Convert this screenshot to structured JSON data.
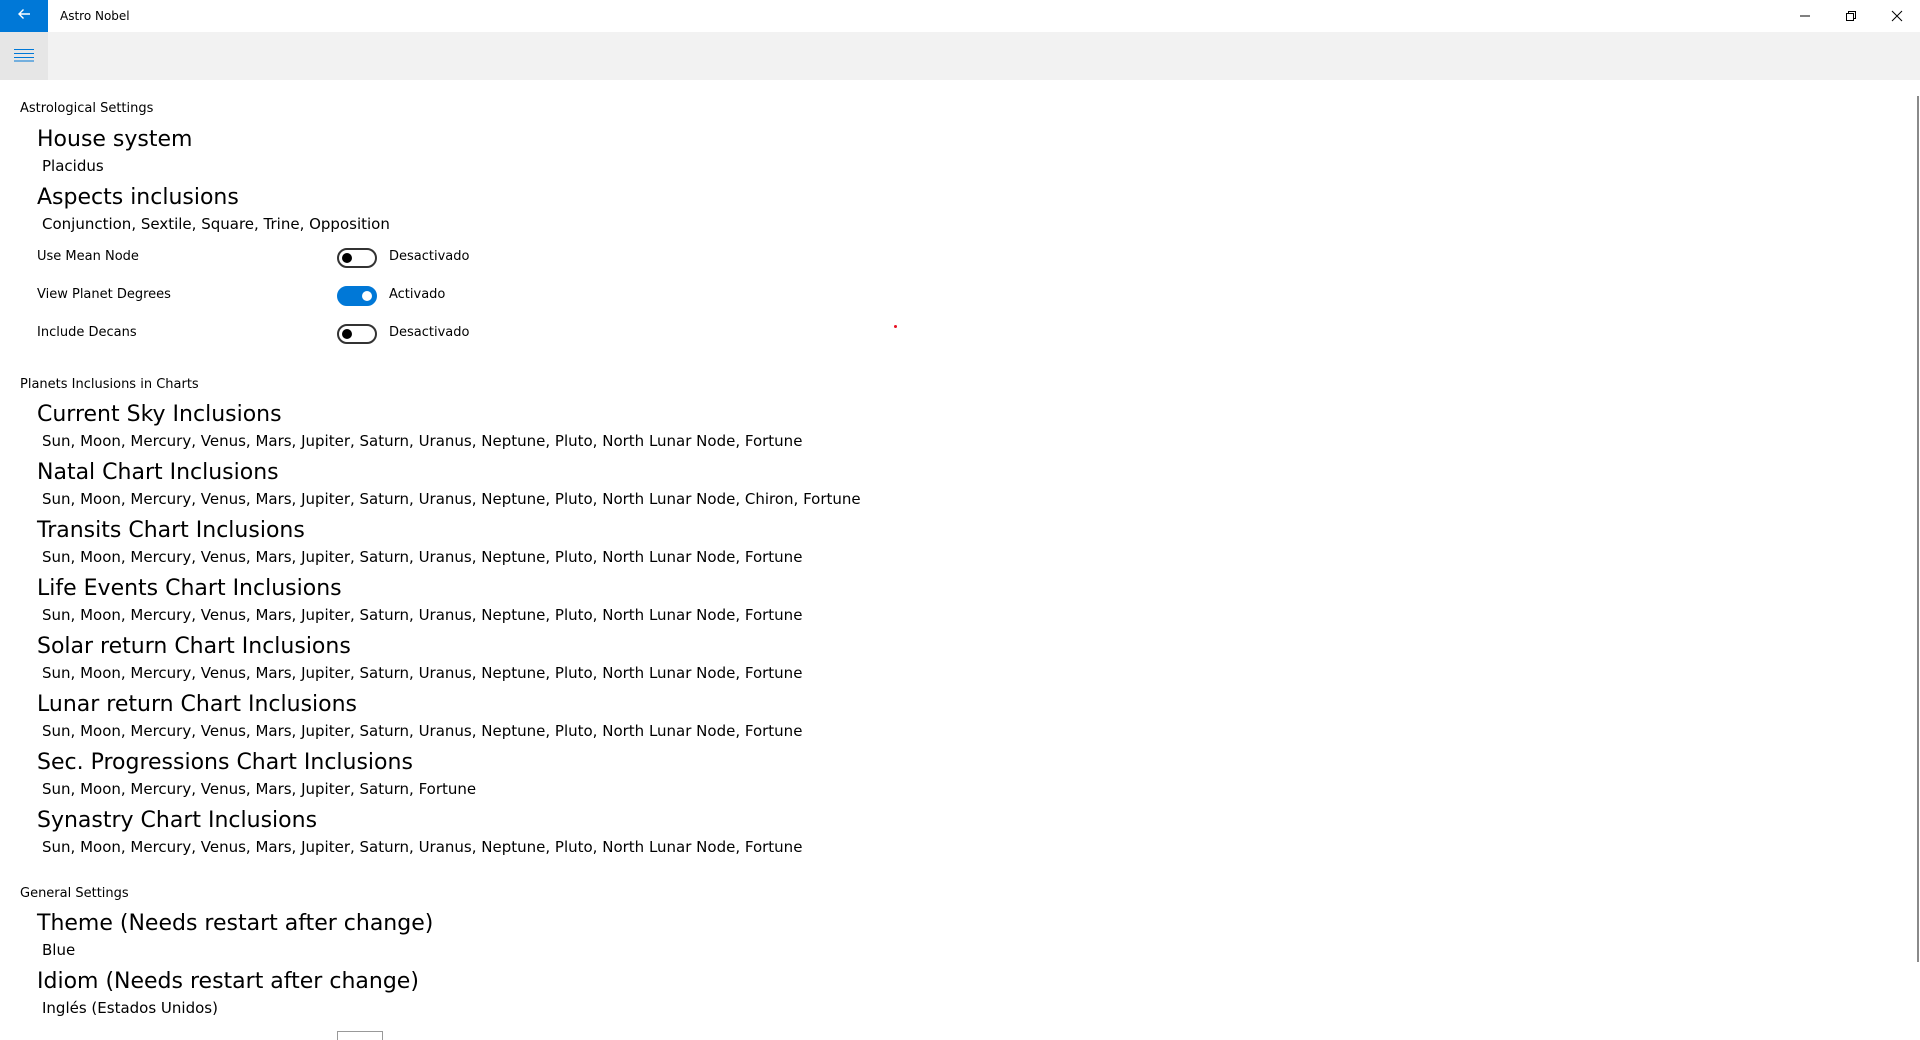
{
  "app": {
    "title": "Astro Nobel"
  },
  "icons": {
    "back": "back-arrow-icon",
    "minimize": "minimize-icon",
    "restore": "restore-icon",
    "close": "close-icon",
    "menu": "hamburger-menu-icon"
  },
  "colors": {
    "accent": "#0078d7",
    "commandbar": "#f2f2f2",
    "indicator": "#e81123"
  },
  "astrological": {
    "section_title": "Astrological Settings",
    "house_system": {
      "label": "House system",
      "value": "Placidus"
    },
    "aspects": {
      "label": "Aspects inclusions",
      "value": "Conjunction, Sextile, Square, Trine, Opposition"
    },
    "toggles": [
      {
        "label": "Use Mean Node",
        "on": false,
        "state": "Desactivado"
      },
      {
        "label": "View Planet Degrees",
        "on": true,
        "state": "Activado"
      },
      {
        "label": "Include Decans",
        "on": false,
        "state": "Desactivado"
      }
    ]
  },
  "planets": {
    "section_title": "Planets Inclusions in Charts",
    "items": [
      {
        "label": "Current Sky Inclusions",
        "value": "Sun, Moon, Mercury, Venus, Mars, Jupiter, Saturn, Uranus, Neptune, Pluto, North Lunar Node, Fortune"
      },
      {
        "label": "Natal Chart Inclusions",
        "value": "Sun, Moon, Mercury, Venus, Mars, Jupiter, Saturn, Uranus, Neptune, Pluto, North Lunar Node, Chiron, Fortune"
      },
      {
        "label": "Transits Chart Inclusions",
        "value": "Sun, Moon, Mercury, Venus, Mars, Jupiter, Saturn, Uranus, Neptune, Pluto, North Lunar Node, Fortune"
      },
      {
        "label": "Life Events Chart Inclusions",
        "value": "Sun, Moon, Mercury, Venus, Mars, Jupiter, Saturn, Uranus, Neptune, Pluto, North Lunar Node, Fortune"
      },
      {
        "label": "Solar return Chart Inclusions",
        "value": "Sun, Moon, Mercury, Venus, Mars, Jupiter, Saturn, Uranus, Neptune, Pluto, North Lunar Node, Fortune"
      },
      {
        "label": "Lunar return Chart Inclusions",
        "value": "Sun, Moon, Mercury, Venus, Mars, Jupiter, Saturn, Uranus, Neptune, Pluto, North Lunar Node, Fortune"
      },
      {
        "label": "Sec. Progressions Chart Inclusions",
        "value": "Sun, Moon, Mercury, Venus, Mars, Jupiter, Saturn, Fortune"
      },
      {
        "label": "Synastry Chart Inclusions",
        "value": "Sun, Moon, Mercury, Venus, Mars, Jupiter, Saturn, Uranus, Neptune, Pluto, North Lunar Node, Fortune"
      }
    ]
  },
  "general": {
    "section_title": "General Settings",
    "theme": {
      "label": "Theme (Needs restart after change)",
      "value": "Blue"
    },
    "idiom": {
      "label": "Idiom (Needs restart after change)",
      "value": "Inglés (Estados Unidos)"
    }
  }
}
